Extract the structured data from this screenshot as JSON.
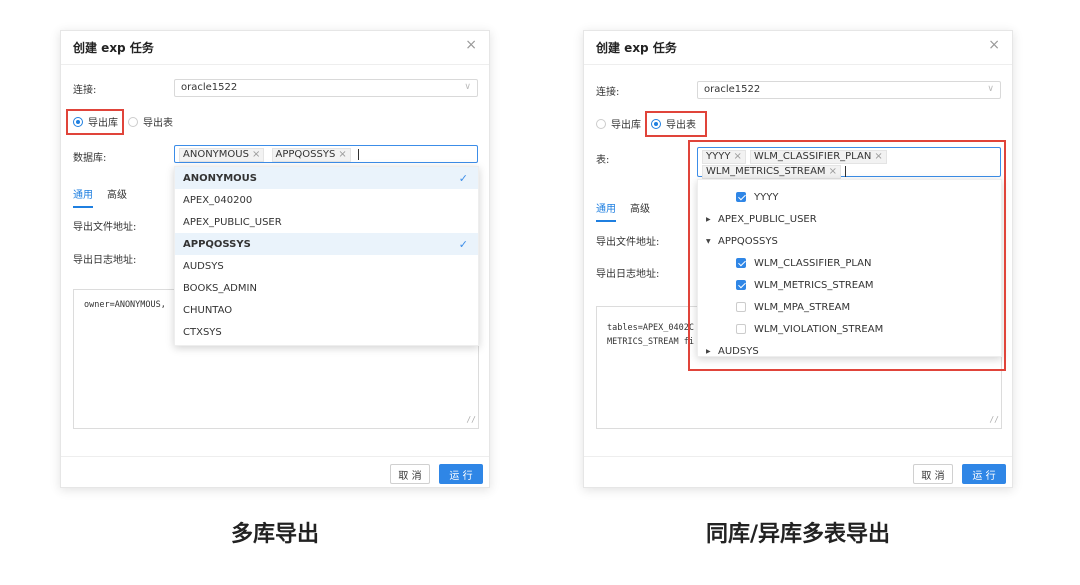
{
  "left": {
    "dialog_title": "创建 exp 任务",
    "close": "×",
    "connection_label": "连接:",
    "connection_value": "oracle1522",
    "radio_db": "导出库",
    "radio_table": "导出表",
    "database_label": "数据库:",
    "tags": [
      "ANONYMOUS",
      "APPQOSSYS"
    ],
    "tab_general": "通用",
    "tab_advanced": "高级",
    "export_file_label": "导出文件地址:",
    "export_log_label": "导出日志地址:",
    "textarea_text": "owner=ANONYMOUS,",
    "dropdown_items": [
      {
        "label": "ANONYMOUS",
        "selected": true
      },
      {
        "label": "APEX_040200",
        "selected": false
      },
      {
        "label": "APEX_PUBLIC_USER",
        "selected": false
      },
      {
        "label": "APPQOSSYS",
        "selected": true
      },
      {
        "label": "AUDSYS",
        "selected": false
      },
      {
        "label": "BOOKS_ADMIN",
        "selected": false
      },
      {
        "label": "CHUNTAO",
        "selected": false
      },
      {
        "label": "CTXSYS",
        "selected": false
      }
    ],
    "cancel": "取 消",
    "run": "运 行",
    "caption": "多库导出"
  },
  "right": {
    "dialog_title": "创建 exp 任务",
    "close": "×",
    "connection_label": "连接:",
    "connection_value": "oracle1522",
    "radio_db": "导出库",
    "radio_table": "导出表",
    "table_label": "表:",
    "tags_line1": [
      "YYYY",
      "WLM_CLASSIFIER_PLAN"
    ],
    "tags_line2": [
      "WLM_METRICS_STREAM"
    ],
    "tab_general": "通用",
    "tab_advanced": "高级",
    "export_file_label": "导出文件地址:",
    "export_log_label": "导出日志地址:",
    "textarea_line1": "tables=APEX_0402C",
    "textarea_line2": "METRICS_STREAM fi",
    "tree": [
      {
        "kind": "leaf",
        "label": "YYYY",
        "checked": true
      },
      {
        "kind": "group",
        "label": "APEX_PUBLIC_USER",
        "expanded": false
      },
      {
        "kind": "group",
        "label": "APPQOSSYS",
        "expanded": true
      },
      {
        "kind": "leaf",
        "label": "WLM_CLASSIFIER_PLAN",
        "checked": true
      },
      {
        "kind": "leaf",
        "label": "WLM_METRICS_STREAM",
        "checked": true
      },
      {
        "kind": "leaf",
        "label": "WLM_MPA_STREAM",
        "checked": false
      },
      {
        "kind": "leaf",
        "label": "WLM_VIOLATION_STREAM",
        "checked": false
      },
      {
        "kind": "group",
        "label": "AUDSYS",
        "expanded": false
      }
    ],
    "cancel": "取 消",
    "run": "运 行",
    "caption": "同库/异库多表导出"
  },
  "colors": {
    "accent": "#2f86e6",
    "highlight": "#e0443a"
  }
}
